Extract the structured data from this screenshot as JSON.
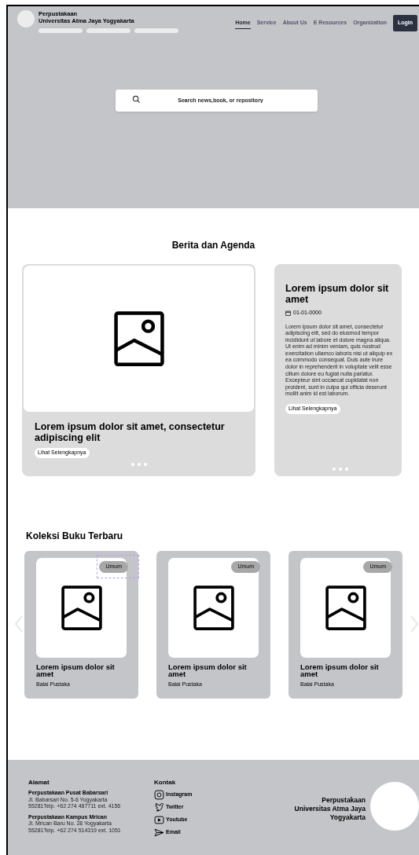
{
  "header": {
    "brand_line_1": "Perpustakaan",
    "brand_line_2": "Universitas Atma Jaya Yogyakarta",
    "nav": [
      {
        "label": "Home",
        "selected": true
      },
      {
        "label": "Service",
        "selected": false
      },
      {
        "label": "About Us",
        "selected": false
      },
      {
        "label": "E Resources",
        "selected": false
      },
      {
        "label": "Organization",
        "selected": false
      }
    ],
    "login": "Login"
  },
  "search": {
    "placeholder": "Search news,book, or repository"
  },
  "news": {
    "title": "Berita dan Agenda",
    "main": {
      "headline": "Lorem ipsum dolor sit amet, consectetur adipiscing elit",
      "link": "Lihat Selengkapnya"
    },
    "side": {
      "headline": "Lorem ipsum dolor sit amet",
      "date": "01-01-0000",
      "body": "Lorem ipsum dolor sit amet, consectetur adipiscing elit, sed do eiusmod tempor incididunt ut labore et dolore magna aliqua. Ut enim ad minim veniam, quis nostrud exercitation ullamco laboris nisi ut aliquip ex ea commodo consequat. Duis aute irure dolor in reprehenderit in voluptate velit esse cillum dolore eu fugiat nulla pariatur. Excepteur sint occaecat cupidatat non proident, sunt in culpa qui officia deserunt mollit anim id est laborum.",
      "link": "Lihat Selengkapnya"
    }
  },
  "books": {
    "title": "Koleksi Buku Terbaru",
    "items": [
      {
        "tag": "Umum",
        "title": "Lorem ipsum dolor sit amet",
        "publisher": "Balai Pustaka",
        "selected": true
      },
      {
        "tag": "Umum",
        "title": "Lorem ipsum dolor sit amet",
        "publisher": "Balai Pustaka",
        "selected": false
      },
      {
        "tag": "Umum",
        "title": "Lorem ipsum dolor sit amet",
        "publisher": "Balai Pustaka",
        "selected": false
      }
    ]
  },
  "footer": {
    "address_title": "Alamat",
    "addresses": [
      {
        "name": "Perpustakaan Pusat Babarsari",
        "line_1": "Jl. Babarsari No. 5-6 Yogyakarta",
        "line_2": "55281Telp. +62 274 487711 ext. 4156"
      },
      {
        "name": "Perpustakaan Kampus Mrican",
        "line_1": "Jl. Mrican Baru No. 28 Yogyakarta",
        "line_2": "55281Telp. +62 274 514319 ext. 1051"
      }
    ],
    "contact_title": "Kontak",
    "contacts": [
      {
        "kind": "instagram",
        "label": "Instagram"
      },
      {
        "kind": "twitter",
        "label": "Twitter"
      },
      {
        "kind": "youtube",
        "label": "Youtube"
      },
      {
        "kind": "email",
        "label": "Email"
      }
    ],
    "brand_line_1": "Perpustakaan",
    "brand_line_2": "Universitas Atma Jaya",
    "brand_line_3": "Yogyakarta"
  }
}
